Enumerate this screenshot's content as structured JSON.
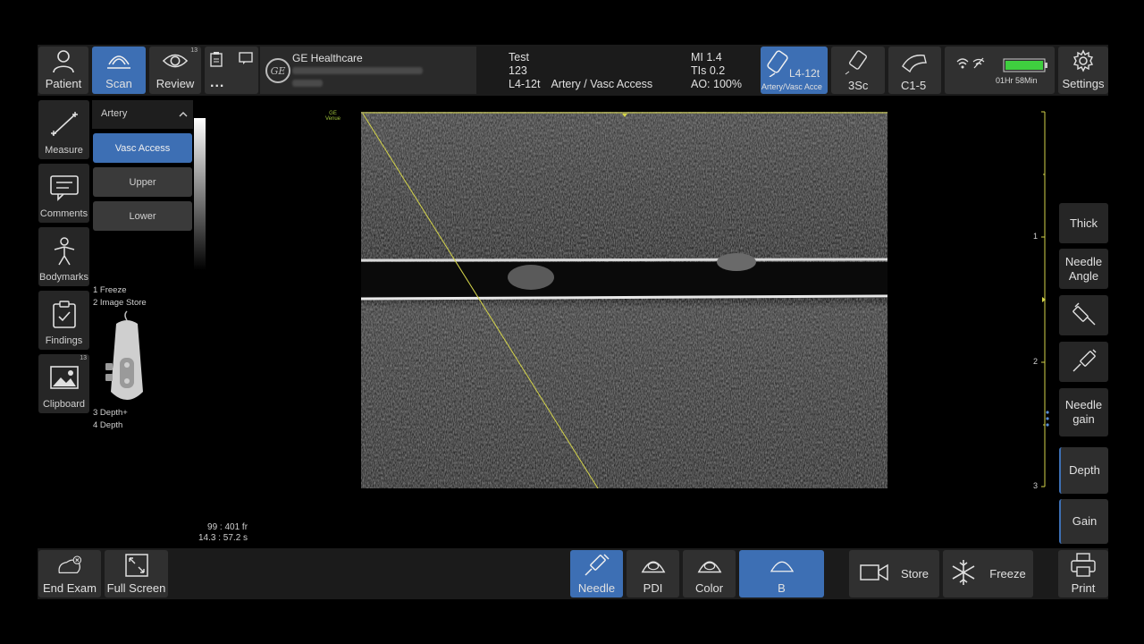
{
  "topbar": {
    "patient_label": "Patient",
    "scan_label": "Scan",
    "review_label": "Review",
    "review_count": "13",
    "more_label": "...",
    "brand": "GE Healthcare",
    "patient_name": "Test",
    "patient_id": "123",
    "probe_name": "L4-12t",
    "preset_name": "Artery / Vasc Access",
    "mi": "MI 1.4",
    "tis": "TIs 0.2",
    "ao": "AO: 100%",
    "active_probe_name": "L4-12t",
    "active_probe_preset": "Artery/Vasc Acce",
    "probe2_label": "3Sc",
    "probe3_label": "C1-5",
    "battery_time": "01Hr 58Min",
    "settings_label": "Settings"
  },
  "sidebar": {
    "measure_label": "Measure",
    "comments_label": "Comments",
    "bodymarks_label": "Bodymarks",
    "findings_label": "Findings",
    "clipboard_label": "Clipboard",
    "clipboard_count": "13"
  },
  "presets": {
    "header": "Artery",
    "items": [
      "Vasc Access",
      "Upper",
      "Lower"
    ],
    "selected": "Vasc Access"
  },
  "key_mapping": {
    "k1": "1  Freeze",
    "k2": "2  Image Store",
    "k3": "3  Depth+",
    "k4": "4  Depth"
  },
  "image": {
    "ge_note_line1": "GE",
    "ge_note_line2": "Venue",
    "frames": "99 : 401 fr",
    "time": "14.3 : 57.2 s"
  },
  "depth_scale": {
    "labels": [
      "1",
      "2",
      "3"
    ]
  },
  "right_controls": {
    "thick": "Thick",
    "needle_angle_1": "Needle",
    "needle_angle_2": "Angle",
    "needle_gain_1": "Needle",
    "needle_gain_2": "gain",
    "depth": "Depth",
    "gain": "Gain"
  },
  "bottombar": {
    "end_exam": "End Exam",
    "full_screen": "Full Screen",
    "needle": "Needle",
    "pdi": "PDI",
    "color": "Color",
    "b": "B",
    "store": "Store",
    "freeze": "Freeze",
    "print": "Print"
  },
  "colors": {
    "accent_blue": "#3d6fb4",
    "button_gray": "#303030",
    "needle_guide_yellow": "#d4d44a",
    "battery_green": "#3fcf3f"
  }
}
